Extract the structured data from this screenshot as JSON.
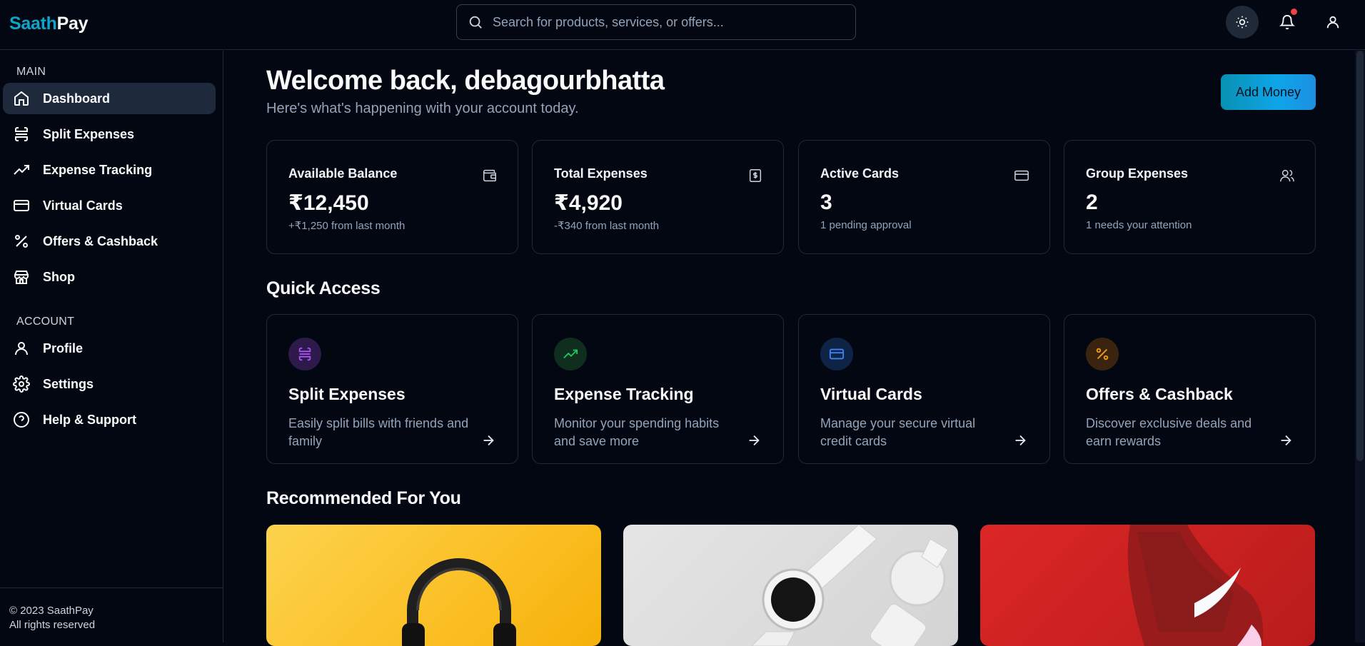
{
  "app": {
    "logo_part1": "Saath",
    "logo_part2": "Pay"
  },
  "search": {
    "placeholder": "Search for products, services, or offers..."
  },
  "header_icons": [
    "sun-icon",
    "bell-icon",
    "user-icon"
  ],
  "colors": {
    "accent": "#0ea5c9",
    "background": "#030712",
    "notification": "#ef4444"
  },
  "sidebar": {
    "main_label": "MAIN",
    "main_items": [
      {
        "label": "Dashboard",
        "icon": "home-icon"
      },
      {
        "label": "Split Expenses",
        "icon": "split-icon"
      },
      {
        "label": "Expense Tracking",
        "icon": "trending-up-icon"
      },
      {
        "label": "Virtual Cards",
        "icon": "credit-card-icon"
      },
      {
        "label": "Offers & Cashback",
        "icon": "percent-icon"
      },
      {
        "label": "Shop",
        "icon": "store-icon"
      }
    ],
    "account_label": "ACCOUNT",
    "account_items": [
      {
        "label": "Profile",
        "icon": "user-icon"
      },
      {
        "label": "Settings",
        "icon": "gear-icon"
      },
      {
        "label": "Help & Support",
        "icon": "help-circle-icon"
      }
    ],
    "footer_line1": "© 2023 SaathPay",
    "footer_line2": "All rights reserved"
  },
  "main": {
    "welcome": "Welcome back, debagourbhatta",
    "subtitle": "Here's what's happening with your account today.",
    "add_money": "Add Money",
    "stats": [
      {
        "title": "Available Balance",
        "value": "₹12,450",
        "sub": "+₹1,250 from last month",
        "icon": "wallet-icon"
      },
      {
        "title": "Total Expenses",
        "value": "₹4,920",
        "sub": "-₹340 from last month",
        "icon": "receipt-icon"
      },
      {
        "title": "Active Cards",
        "value": "3",
        "sub": "1 pending approval",
        "icon": "credit-card-icon"
      },
      {
        "title": "Group Expenses",
        "value": "2",
        "sub": "1 needs your attention",
        "icon": "users-icon"
      }
    ],
    "quick_access_title": "Quick Access",
    "quick_access": [
      {
        "title": "Split Expenses",
        "desc": "Easily split bills with friends and family",
        "color": "#a855f7"
      },
      {
        "title": "Expense Tracking",
        "desc": "Monitor your spending habits and save more",
        "color": "#22c55e"
      },
      {
        "title": "Virtual Cards",
        "desc": "Manage your secure virtual credit cards",
        "color": "#3b82f6"
      },
      {
        "title": "Offers & Cashback",
        "desc": "Discover exclusive deals and earn rewards",
        "color": "#f59e0b"
      }
    ],
    "recommended_title": "Recommended For You",
    "recommended": [
      {
        "image": "headphones-image"
      },
      {
        "image": "smartwatch-image"
      },
      {
        "image": "sneaker-image"
      }
    ]
  }
}
